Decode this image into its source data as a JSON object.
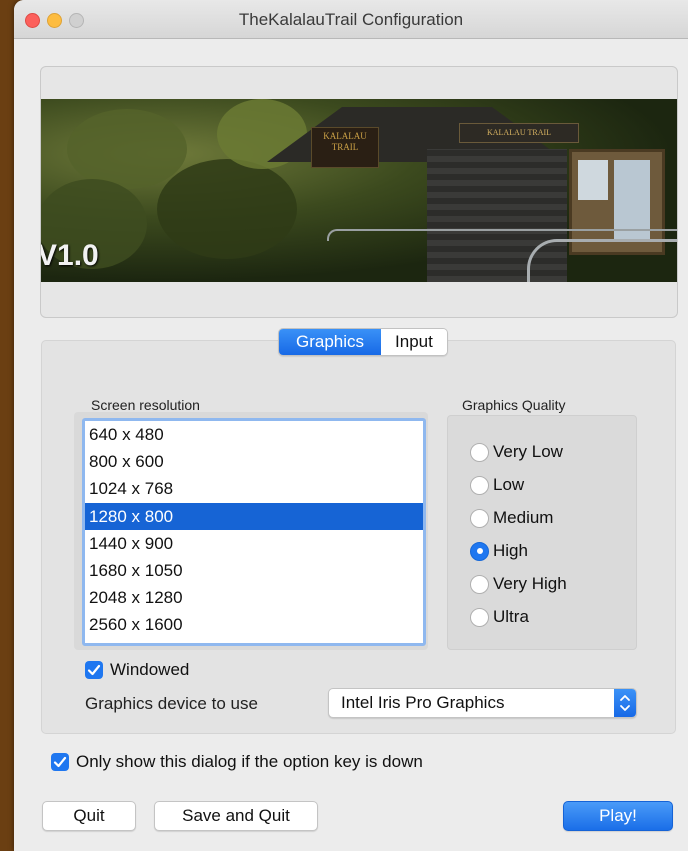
{
  "window": {
    "title": "TheKalalauTrail Configuration"
  },
  "banner": {
    "version_text": "V1.0",
    "sign_text": "KALALAU TRAIL",
    "kiosk_text": "KALALAU TRAIL"
  },
  "tabs": [
    {
      "label": "Graphics",
      "active": true
    },
    {
      "label": "Input",
      "active": false
    }
  ],
  "graphics": {
    "resolution_label": "Screen resolution",
    "resolutions": [
      "640 x 480",
      "800 x 600",
      "1024 x 768",
      "1280 x 800",
      "1440 x 900",
      "1680 x 1050",
      "2048 x 1280",
      "2560 x 1600"
    ],
    "selected_resolution": "1280 x 800",
    "quality_label": "Graphics Quality",
    "qualities": [
      "Very Low",
      "Low",
      "Medium",
      "High",
      "Very High",
      "Ultra"
    ],
    "selected_quality": "High",
    "windowed_label": "Windowed",
    "windowed_checked": true,
    "device_label": "Graphics device to use",
    "device_value": "Intel Iris Pro Graphics"
  },
  "option_key": {
    "label": "Only show this dialog if the option key is down",
    "checked": true
  },
  "buttons": {
    "quit": "Quit",
    "save_quit": "Save and Quit",
    "play": "Play!"
  },
  "colors": {
    "accent": "#1f77f0",
    "selection": "#1664d5",
    "titlebar": "#d6d6d6"
  }
}
